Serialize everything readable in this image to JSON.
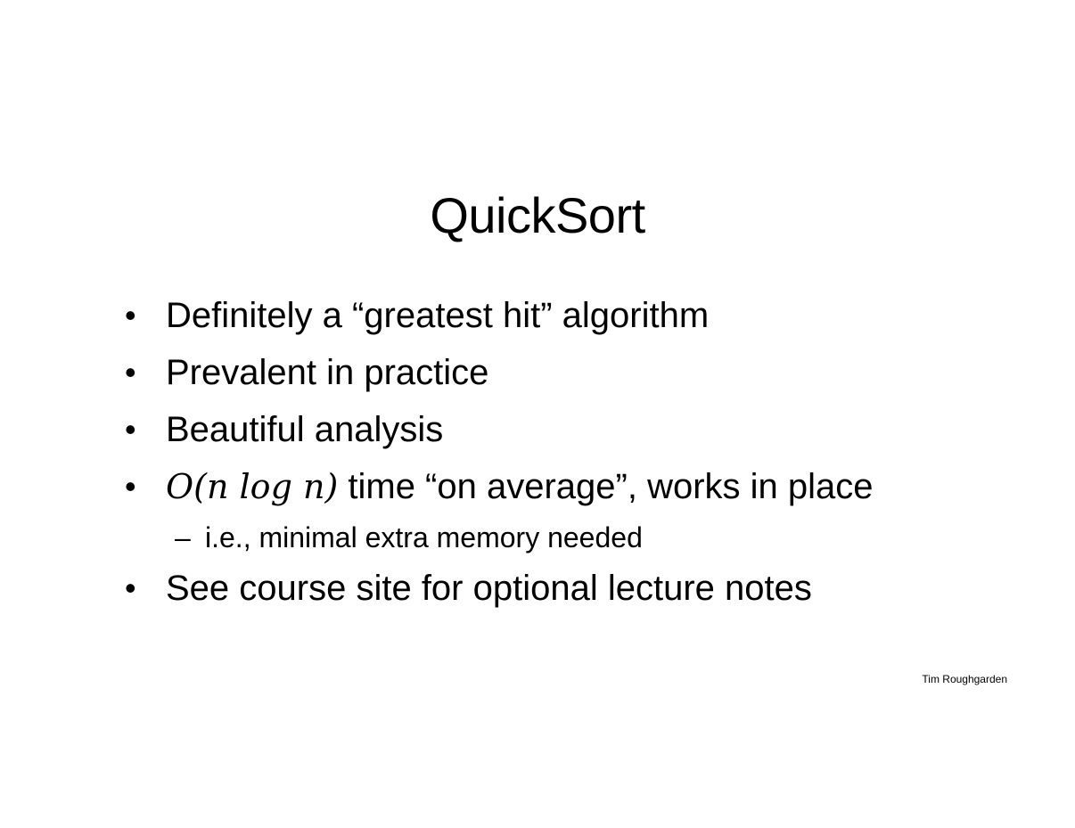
{
  "slide": {
    "title": "QuickSort",
    "bullets": {
      "b1": "Definitely a “greatest hit” algorithm",
      "b2": "Prevalent in practice",
      "b3": "Beautiful analysis",
      "b4": {
        "math": "O(n  log n)",
        "text": " time “on average”, works in place"
      },
      "b4_sub": "i.e., minimal extra memory needed",
      "b5": "See course site for optional lecture notes"
    },
    "author": "Tim Roughgarden"
  }
}
